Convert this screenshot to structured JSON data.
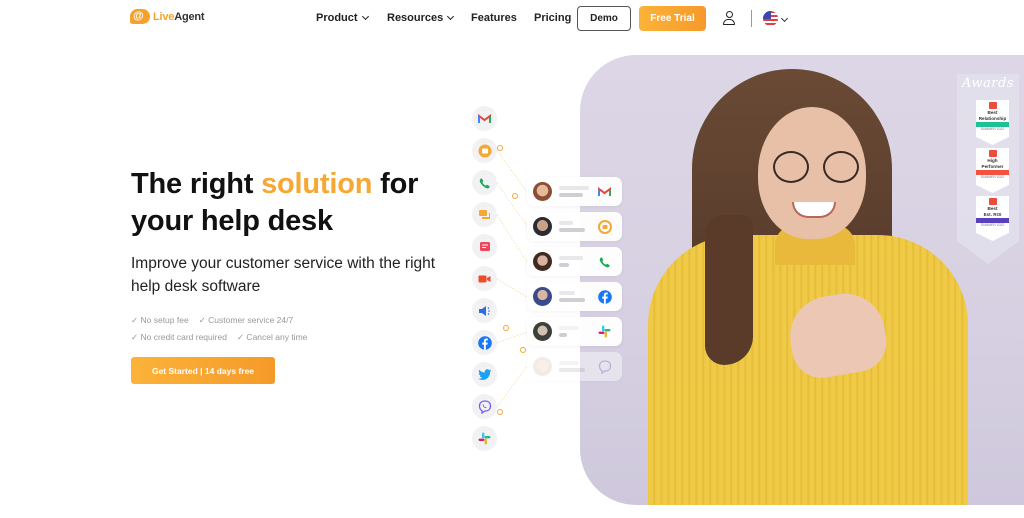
{
  "nav": {
    "logo_prefix": "Live",
    "logo_suffix": "Agent",
    "logo_mark": "@",
    "items": [
      {
        "label": "Product",
        "has_dropdown": true
      },
      {
        "label": "Resources",
        "has_dropdown": true
      },
      {
        "label": "Features",
        "has_dropdown": false
      },
      {
        "label": "Pricing",
        "has_dropdown": false
      }
    ],
    "demo_label": "Demo",
    "trial_label": "Free Trial",
    "account_icon": "user-icon",
    "language_icon": "us-flag-icon"
  },
  "hero": {
    "headline_before": "The right ",
    "headline_accent": "solution",
    "headline_after": " for your help desk",
    "subheadline": "Improve your customer service with the right help desk software",
    "features": [
      "✓ No setup fee",
      "✓ Customer service 24/7",
      "✓ No credit card required",
      "✓ Cancel any time"
    ],
    "cta_label": "Get Started | 14 days free"
  },
  "channels": [
    {
      "name": "gmail",
      "icon": "gmail-icon"
    },
    {
      "name": "live chat",
      "icon": "chat-icon"
    },
    {
      "name": "phone",
      "icon": "phone-icon"
    },
    {
      "name": "messages",
      "icon": "messages-icon"
    },
    {
      "name": "forms",
      "icon": "form-icon"
    },
    {
      "name": "video",
      "icon": "video-icon"
    },
    {
      "name": "announcements",
      "icon": "megaphone-icon"
    },
    {
      "name": "facebook",
      "icon": "facebook-icon"
    },
    {
      "name": "twitter",
      "icon": "twitter-icon"
    },
    {
      "name": "viber",
      "icon": "viber-icon"
    },
    {
      "name": "slack",
      "icon": "slack-icon"
    }
  ],
  "conversations": [
    {
      "channel": "gmail",
      "icon": "gmail-icon"
    },
    {
      "channel": "live chat",
      "icon": "chat-icon"
    },
    {
      "channel": "phone",
      "icon": "phone-icon"
    },
    {
      "channel": "facebook",
      "icon": "facebook-icon"
    },
    {
      "channel": "slack",
      "icon": "slack-icon"
    },
    {
      "channel": "viber",
      "icon": "viber-icon"
    }
  ],
  "awards": {
    "title": "Awards",
    "badges": [
      {
        "line1": "Best",
        "line2": "Relationship",
        "ribbon": "Small Business",
        "season": "SUMMER 2022",
        "ribbon_color": "#1fc194"
      },
      {
        "line1": "High",
        "line2": "Performer",
        "ribbon": "Mid-Market",
        "season": "SUMMER 2022",
        "ribbon_color": "#f2523e"
      },
      {
        "line1": "Best",
        "line2": "Est. ROI",
        "ribbon": "Enterprise",
        "season": "SUMMER 2022",
        "ribbon_color": "#5a3fc0"
      }
    ]
  },
  "colors": {
    "accent": "#f5a834",
    "cta_gradient_start": "#fbb33a",
    "cta_gradient_end": "#f59a2a",
    "hero_background": "#dcd6e6",
    "sweater": "#eec640"
  }
}
